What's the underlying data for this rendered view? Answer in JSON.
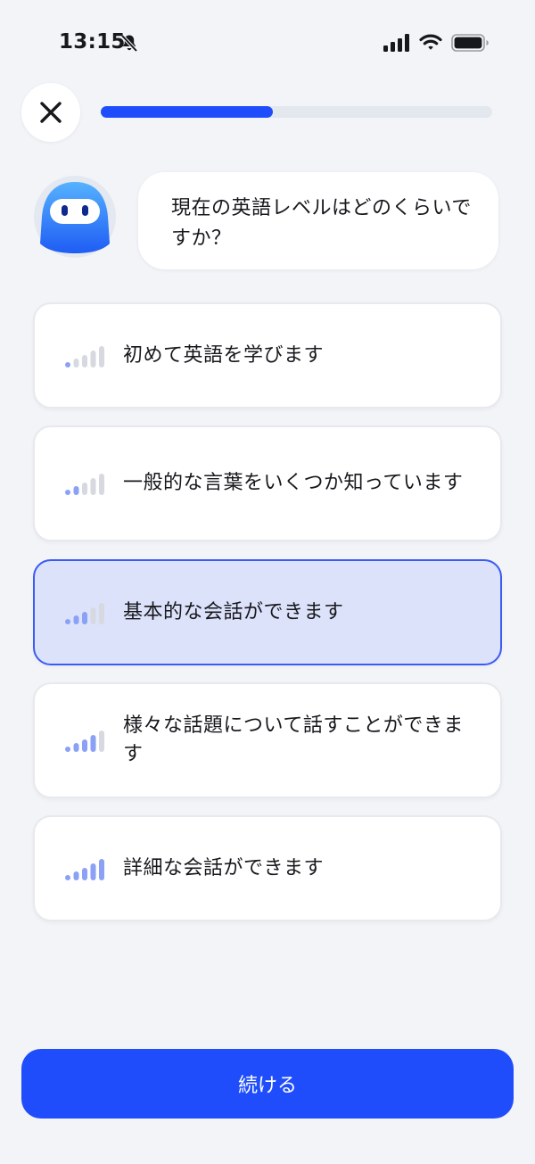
{
  "status_bar": {
    "time": "13:15"
  },
  "progress": {
    "fraction": 0.44,
    "color": "#1f4dfb"
  },
  "question": {
    "text": "現在の英語レベルはどのくらいですか？"
  },
  "options": [
    {
      "label": "初めて英語を学びます",
      "level": 1,
      "selected": false
    },
    {
      "label": "一般的な言葉をいくつか知っています",
      "level": 2,
      "selected": false
    },
    {
      "label": "基本的な会話ができます",
      "level": 3,
      "selected": true
    },
    {
      "label": "様々な話題について話すことができます",
      "level": 4,
      "selected": false
    },
    {
      "label": "詳細な会話ができます",
      "level": 5,
      "selected": false
    }
  ],
  "continue_button": {
    "label": "続ける"
  },
  "colors": {
    "accent": "#1f4dfb",
    "bar_active": "#8aa1f5",
    "bar_inactive": "#d6d9e0"
  }
}
